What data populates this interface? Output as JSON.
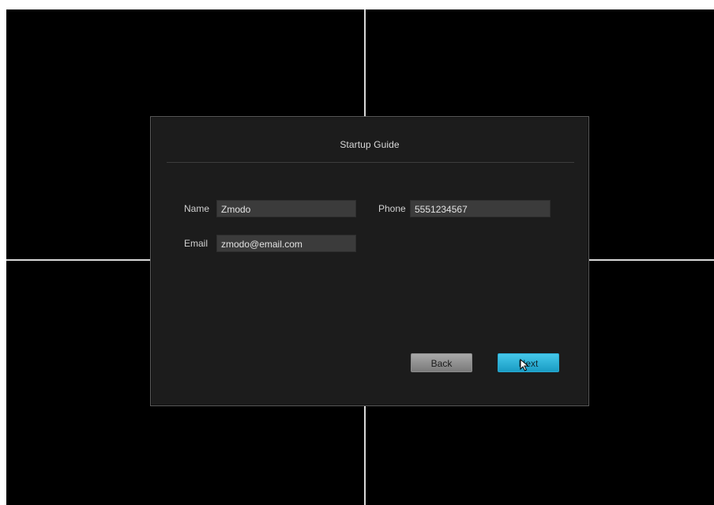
{
  "dialog": {
    "title": "Startup Guide"
  },
  "form": {
    "name_label": "Name",
    "name_value": "Zmodo",
    "phone_label": "Phone",
    "phone_value": "5551234567",
    "email_label": "Email",
    "email_value": "zmodo@email.com"
  },
  "buttons": {
    "back_label": "Back",
    "next_label": "Next"
  },
  "colors": {
    "next_accent": "#2bb4dc",
    "back_gray": "#9a9a9a",
    "background": "#000000",
    "dialog_bg": "#1c1c1c"
  },
  "icons": {
    "cursor": "mouse-pointer-icon"
  }
}
